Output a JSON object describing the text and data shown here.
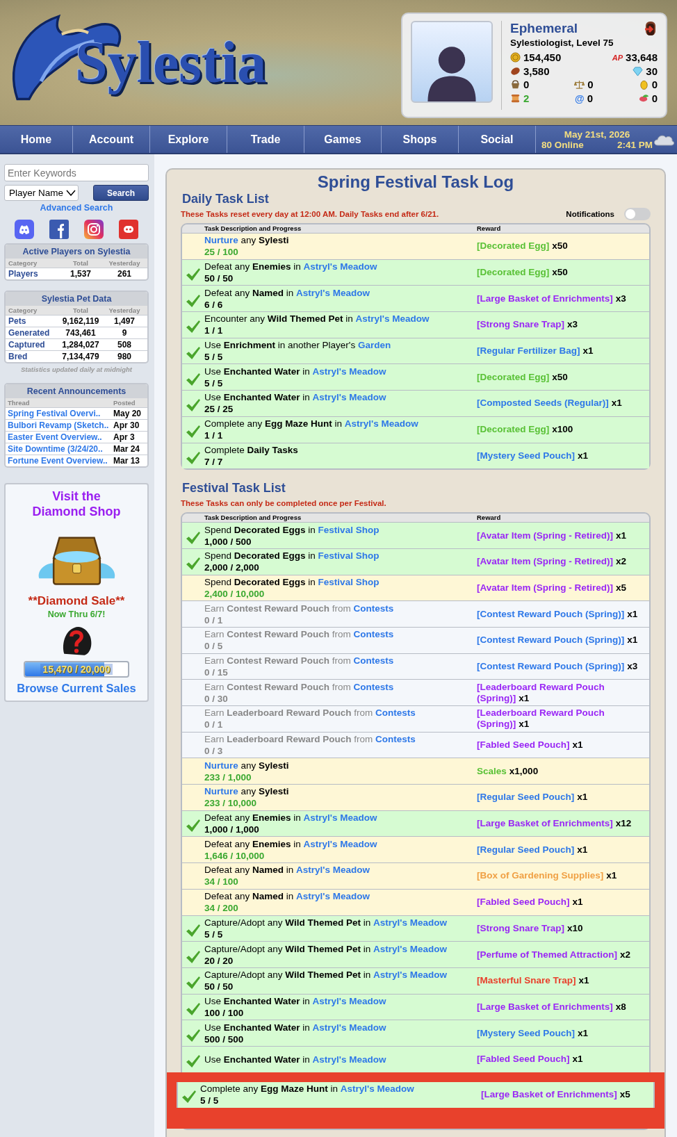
{
  "header": {
    "site_name": "Sylestia",
    "user": {
      "name": "Ephemeral",
      "title": "Sylestiologist, Level 75",
      "currencies": [
        {
          "kind": "coin",
          "value": "154,450"
        },
        {
          "kind": "ap",
          "label": "AP",
          "value": "33,648"
        },
        {
          "kind": "bean",
          "value": "3,580"
        },
        {
          "kind": "diamond",
          "value": "30"
        }
      ],
      "counters": [
        {
          "kind": "basket",
          "value": "0",
          "alert": false
        },
        {
          "kind": "scale",
          "value": "0",
          "alert": false
        },
        {
          "kind": "egg",
          "value": "0",
          "alert": false
        },
        {
          "kind": "scroll",
          "value": "2",
          "alert": true
        },
        {
          "kind": "at",
          "label": "@",
          "value": "0",
          "alert": false
        },
        {
          "kind": "food",
          "value": "0",
          "alert": false
        }
      ]
    }
  },
  "nav": {
    "items": [
      "Home",
      "Account",
      "Explore",
      "Trade",
      "Games",
      "Shops",
      "Social"
    ],
    "date": "May 21st, 2026",
    "online": "80 Online",
    "time": "2:41 PM"
  },
  "sidebar": {
    "search": {
      "placeholder": "Enter Keywords",
      "type": "Player Name",
      "button": "Search",
      "advanced": "Advanced Search"
    },
    "stat_boxes": [
      {
        "title": "Active Players on Sylestia",
        "columns": [
          "Category",
          "Total",
          "Yesterday"
        ],
        "rows": [
          [
            "Players",
            "1,537",
            "261"
          ]
        ]
      },
      {
        "title": "Sylestia Pet Data",
        "columns": [
          "Category",
          "Total",
          "Yesterday"
        ],
        "rows": [
          [
            "Pets",
            "9,162,119",
            "1,497"
          ],
          [
            "Generated",
            "743,461",
            "9"
          ],
          [
            "Captured",
            "1,284,027",
            "508"
          ],
          [
            "Bred",
            "7,134,479",
            "980"
          ]
        ],
        "footnote": "Statistics updated daily at midnight"
      }
    ],
    "announcements": {
      "title": "Recent Announcements",
      "columns": [
        "Thread",
        "Posted"
      ],
      "rows": [
        {
          "thread": "Spring Festival Overvi..",
          "posted": "May 20"
        },
        {
          "thread": "Bulbori Revamp (Sketch..",
          "posted": "Apr 30"
        },
        {
          "thread": "Easter Event Overview..",
          "posted": "Apr 3"
        },
        {
          "thread": "Site Downtime (3/24/20..",
          "posted": "Mar 24"
        },
        {
          "thread": "Fortune Event Overview..",
          "posted": "Mar 13"
        }
      ]
    },
    "diamond_shop": {
      "title": "Visit the Diamond Shop",
      "sale": "**Diamond Sale**",
      "subtitle": "Now Thru 6/7!",
      "progress": {
        "level": 0.7735,
        "text": "15,470 / 20,000"
      },
      "link": "Browse Current Sales"
    }
  },
  "main": {
    "title": "Spring Festival Task Log",
    "sections": [
      {
        "heading": "Daily Task List",
        "notice": "These Tasks reset every day at 12:00 AM. Daily Tasks end after 6/21.",
        "notifications": {
          "label": "Notifications",
          "on": false
        },
        "columns": [
          "Task Description and Progress",
          "Reward"
        ],
        "tasks": [
          {
            "completed": false,
            "started": true,
            "description": [
              {
                "kind": "link",
                "text": "Nurture"
              },
              {
                "kind": "text",
                "text": "any **Sylesti**"
              }
            ],
            "progress": "25 / 100",
            "reward": {
              "item": "[Decorated Egg]",
              "color": "#59c136",
              "quantity": "x50"
            }
          },
          {
            "completed": true,
            "started": true,
            "description": [
              {
                "kind": "text",
                "text": "Defeat any **Enemies** in"
              },
              {
                "kind": "link",
                "text": "Astryl's Meadow"
              }
            ],
            "progress": "50 / 50",
            "reward": {
              "item": "[Decorated Egg]",
              "color": "#59c136",
              "quantity": "x50"
            }
          },
          {
            "completed": true,
            "started": true,
            "description": [
              {
                "kind": "text",
                "text": "Defeat any **Named** in"
              },
              {
                "kind": "link",
                "text": "Astryl's Meadow"
              }
            ],
            "progress": "6 / 6",
            "reward": {
              "item": "[Large Basket of Enrichments]",
              "color": "#9a27f5",
              "quantity": "x3"
            }
          },
          {
            "completed": true,
            "started": true,
            "description": [
              {
                "kind": "text",
                "text": "Encounter any **Wild Themed Pet** in"
              },
              {
                "kind": "link",
                "text": "Astryl's Meadow"
              }
            ],
            "progress": "1 / 1",
            "reward": {
              "item": "[Strong Snare Trap]",
              "color": "#9a27f5",
              "quantity": "x3"
            }
          },
          {
            "completed": true,
            "started": true,
            "description": [
              {
                "kind": "text",
                "text": "Use **Enrichment** in another Player's"
              },
              {
                "kind": "link",
                "text": "Garden"
              }
            ],
            "progress": "5 / 5",
            "reward": {
              "item": "[Regular Fertilizer Bag]",
              "color": "#2e78e8",
              "quantity": "x1"
            }
          },
          {
            "completed": true,
            "started": true,
            "description": [
              {
                "kind": "text",
                "text": "Use **Enchanted Water** in"
              },
              {
                "kind": "link",
                "text": "Astryl's Meadow"
              }
            ],
            "progress": "5 / 5",
            "reward": {
              "item": "[Decorated Egg]",
              "color": "#59c136",
              "quantity": "x50"
            }
          },
          {
            "completed": true,
            "started": true,
            "description": [
              {
                "kind": "text",
                "text": "Use **Enchanted Water** in"
              },
              {
                "kind": "link",
                "text": "Astryl's Meadow"
              }
            ],
            "progress": "25 / 25",
            "reward": {
              "item": "[Composted Seeds (Regular)]",
              "color": "#2e78e8",
              "quantity": "x1"
            }
          },
          {
            "completed": true,
            "started": true,
            "description": [
              {
                "kind": "text",
                "text": "Complete any **Egg Maze Hunt** in"
              },
              {
                "kind": "link",
                "text": "Astryl's Meadow"
              }
            ],
            "progress": "1 / 1",
            "reward": {
              "item": "[Decorated Egg]",
              "color": "#59c136",
              "quantity": "x100"
            }
          },
          {
            "completed": true,
            "started": true,
            "description": [
              {
                "kind": "text",
                "text": "Complete **Daily Tasks**"
              }
            ],
            "progress": "7 / 7",
            "reward": {
              "item": "[Mystery Seed Pouch]",
              "color": "#2e78e8",
              "quantity": "x1"
            }
          }
        ]
      },
      {
        "heading": "Festival Task List",
        "notice": "These Tasks can only be completed once per Festival.",
        "columns": [
          "Task Description and Progress",
          "Reward"
        ],
        "tasks": [
          {
            "completed": true,
            "started": true,
            "description": [
              {
                "kind": "text",
                "text": "Spend **Decorated Eggs** in"
              },
              {
                "kind": "link",
                "text": "Festival Shop"
              }
            ],
            "progress": "1,000 / 500",
            "reward": {
              "item": "[Avatar Item (Spring - Retired)]",
              "color": "#9a27f5",
              "quantity": "x1"
            }
          },
          {
            "completed": true,
            "started": true,
            "description": [
              {
                "kind": "text",
                "text": "Spend **Decorated Eggs** in"
              },
              {
                "kind": "link",
                "text": "Festival Shop"
              }
            ],
            "progress": "2,000 / 2,000",
            "reward": {
              "item": "[Avatar Item (Spring - Retired)]",
              "color": "#9a27f5",
              "quantity": "x2"
            }
          },
          {
            "completed": false,
            "started": true,
            "description": [
              {
                "kind": "text",
                "text": "Spend **Decorated Eggs** in"
              },
              {
                "kind": "link",
                "text": "Festival Shop"
              }
            ],
            "progress": "2,400 / 10,000",
            "reward": {
              "item": "[Avatar Item (Spring - Retired)]",
              "color": "#9a27f5",
              "quantity": "x5"
            }
          },
          {
            "completed": false,
            "started": false,
            "description": [
              {
                "kind": "text",
                "text": "Earn **Contest Reward Pouch** from"
              },
              {
                "kind": "link",
                "text": "Contests"
              }
            ],
            "progress": "0 / 1",
            "reward": {
              "item": "[Contest Reward Pouch (Spring)]",
              "color": "#2e78e8",
              "quantity": "x1"
            }
          },
          {
            "completed": false,
            "started": false,
            "description": [
              {
                "kind": "text",
                "text": "Earn **Contest Reward Pouch** from"
              },
              {
                "kind": "link",
                "text": "Contests"
              }
            ],
            "progress": "0 / 5",
            "reward": {
              "item": "[Contest Reward Pouch (Spring)]",
              "color": "#2e78e8",
              "quantity": "x1"
            }
          },
          {
            "completed": false,
            "started": false,
            "description": [
              {
                "kind": "text",
                "text": "Earn **Contest Reward Pouch** from"
              },
              {
                "kind": "link",
                "text": "Contests"
              }
            ],
            "progress": "0 / 15",
            "reward": {
              "item": "[Contest Reward Pouch (Spring)]",
              "color": "#2e78e8",
              "quantity": "x3"
            }
          },
          {
            "completed": false,
            "started": false,
            "description": [
              {
                "kind": "text",
                "text": "Earn **Contest Reward Pouch** from"
              },
              {
                "kind": "link",
                "text": "Contests"
              }
            ],
            "progress": "0 / 30",
            "reward": {
              "item": "[Leaderboard Reward Pouch (Spring)]",
              "color": "#9a27f5",
              "quantity": "x1"
            }
          },
          {
            "completed": false,
            "started": false,
            "description": [
              {
                "kind": "text",
                "text": "Earn **Leaderboard Reward Pouch** from"
              },
              {
                "kind": "link",
                "text": "Contests"
              }
            ],
            "progress": "0 / 1",
            "reward": {
              "item": "[Leaderboard Reward Pouch (Spring)]",
              "color": "#9a27f5",
              "quantity": "x1"
            }
          },
          {
            "completed": false,
            "started": false,
            "description": [
              {
                "kind": "text",
                "text": "Earn **Leaderboard Reward Pouch** from"
              },
              {
                "kind": "link",
                "text": "Contests"
              }
            ],
            "progress": "0 / 3",
            "reward": {
              "item": "[Fabled Seed Pouch]",
              "color": "#9a27f5",
              "quantity": "x1"
            }
          },
          {
            "completed": false,
            "started": true,
            "description": [
              {
                "kind": "link",
                "text": "Nurture"
              },
              {
                "kind": "text",
                "text": "any **Sylesti**"
              }
            ],
            "progress": "233 / 1,000",
            "reward": {
              "item": "Scales",
              "color": "#59c136",
              "quantity": "x1,000"
            }
          },
          {
            "completed": false,
            "started": true,
            "description": [
              {
                "kind": "link",
                "text": "Nurture"
              },
              {
                "kind": "text",
                "text": "any **Sylesti**"
              }
            ],
            "progress": "233 / 10,000",
            "reward": {
              "item": "[Regular Seed Pouch]",
              "color": "#2e78e8",
              "quantity": "x1"
            }
          },
          {
            "completed": true,
            "started": true,
            "description": [
              {
                "kind": "text",
                "text": "Defeat any **Enemies** in"
              },
              {
                "kind": "link",
                "text": "Astryl's Meadow"
              }
            ],
            "progress": "1,000 / 1,000",
            "reward": {
              "item": "[Large Basket of Enrichments]",
              "color": "#9a27f5",
              "quantity": "x12"
            }
          },
          {
            "completed": false,
            "started": true,
            "description": [
              {
                "kind": "text",
                "text": "Defeat any **Enemies** in"
              },
              {
                "kind": "link",
                "text": "Astryl's Meadow"
              }
            ],
            "progress": "1,646 / 10,000",
            "reward": {
              "item": "[Regular Seed Pouch]",
              "color": "#2e78e8",
              "quantity": "x1"
            }
          },
          {
            "completed": false,
            "started": true,
            "description": [
              {
                "kind": "text",
                "text": "Defeat any **Named** in"
              },
              {
                "kind": "link",
                "text": "Astryl's Meadow"
              }
            ],
            "progress": "34 / 100",
            "reward": {
              "item": "[Box of Gardening Supplies]",
              "color": "#f0a044",
              "quantity": "x1"
            }
          },
          {
            "completed": false,
            "started": true,
            "description": [
              {
                "kind": "text",
                "text": "Defeat any **Named** in"
              },
              {
                "kind": "link",
                "text": "Astryl's Meadow"
              }
            ],
            "progress": "34 / 200",
            "reward": {
              "item": "[Fabled Seed Pouch]",
              "color": "#9a27f5",
              "quantity": "x1"
            }
          },
          {
            "completed": true,
            "started": true,
            "description": [
              {
                "kind": "text",
                "text": "Capture/Adopt any **Wild Themed Pet** in"
              },
              {
                "kind": "link",
                "text": "Astryl's Meadow"
              }
            ],
            "progress": "5 / 5",
            "reward": {
              "item": "[Strong Snare Trap]",
              "color": "#9a27f5",
              "quantity": "x10"
            }
          },
          {
            "completed": true,
            "started": true,
            "description": [
              {
                "kind": "text",
                "text": "Capture/Adopt any **Wild Themed Pet** in"
              },
              {
                "kind": "link",
                "text": "Astryl's Meadow"
              }
            ],
            "progress": "20 / 20",
            "reward": {
              "item": "[Perfume of Themed Attraction]",
              "color": "#9a27f5",
              "quantity": "x2"
            }
          },
          {
            "completed": true,
            "started": true,
            "description": [
              {
                "kind": "text",
                "text": "Capture/Adopt any **Wild Themed Pet** in"
              },
              {
                "kind": "link",
                "text": "Astryl's Meadow"
              }
            ],
            "progress": "50 / 50",
            "reward": {
              "item": "[Masterful Snare Trap]",
              "color": "#e8402c",
              "quantity": "x1"
            }
          },
          {
            "completed": true,
            "started": true,
            "description": [
              {
                "kind": "text",
                "text": "Use **Enchanted Water** in"
              },
              {
                "kind": "link",
                "text": "Astryl's Meadow"
              }
            ],
            "progress": "100 / 100",
            "reward": {
              "item": "[Large Basket of Enrichments]",
              "color": "#9a27f5",
              "quantity": "x8"
            }
          },
          {
            "completed": true,
            "started": true,
            "description": [
              {
                "kind": "text",
                "text": "Use **Enchanted Water** in"
              },
              {
                "kind": "link",
                "text": "Astryl's Meadow"
              }
            ],
            "progress": "500 / 500",
            "reward": {
              "item": "[Mystery Seed Pouch]",
              "color": "#2e78e8",
              "quantity": "x1"
            }
          },
          {
            "completed": true,
            "started": true,
            "description": [
              {
                "kind": "text",
                "text": "Use **Enchanted Water** in"
              },
              {
                "kind": "link",
                "text": "Astryl's Meadow"
              }
            ],
            "reward": {
              "item": "[Fabled Seed Pouch]",
              "color": "#9a27f5",
              "quantity": "x1"
            }
          }
        ],
        "highlighted_task": {
          "completed": true,
          "started": true,
          "description": [
            {
              "kind": "text",
              "text": "Complete any **Egg Maze Hunt** in"
            },
            {
              "kind": "link",
              "text": "Astryl's Meadow"
            }
          ],
          "progress": "5 / 5",
          "reward": {
            "item": "[Large Basket of Enrichments]",
            "color": "#9a27f5",
            "quantity": "x5"
          }
        }
      }
    ]
  }
}
